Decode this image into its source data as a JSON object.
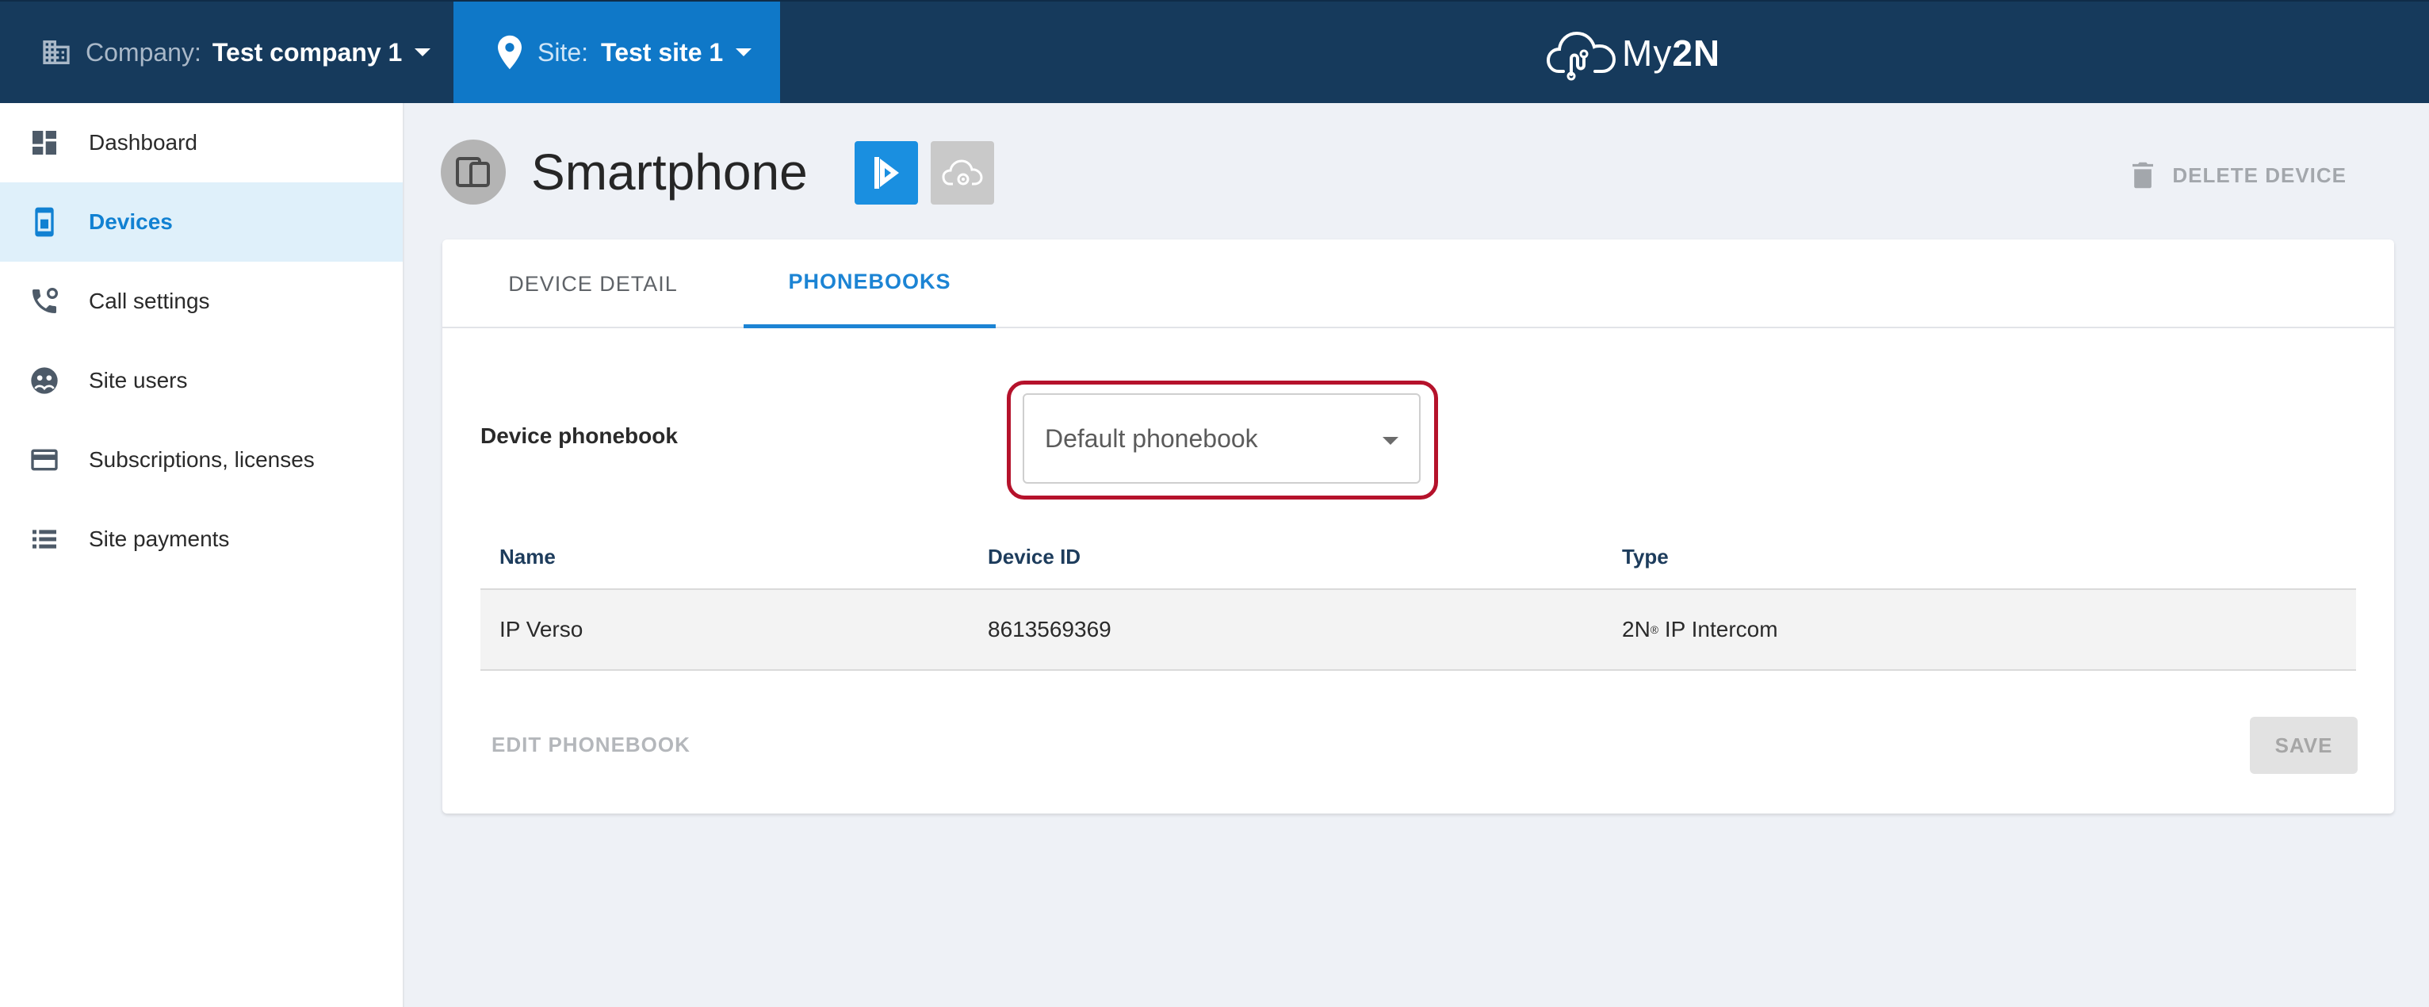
{
  "topbar": {
    "company_label": "Company:",
    "company_value": "Test company 1",
    "site_label": "Site:",
    "site_value": "Test site 1",
    "logo_text_a": "My",
    "logo_text_b": "2N"
  },
  "sidebar": {
    "items": [
      {
        "label": "Dashboard",
        "icon": "dashboard-icon"
      },
      {
        "label": "Devices",
        "icon": "devices-icon",
        "active": true
      },
      {
        "label": "Call settings",
        "icon": "call-settings-icon"
      },
      {
        "label": "Site users",
        "icon": "site-users-icon"
      },
      {
        "label": "Subscriptions, licenses",
        "icon": "credit-card-icon"
      },
      {
        "label": "Site payments",
        "icon": "list-icon"
      }
    ]
  },
  "header": {
    "title": "Smartphone",
    "delete_label": "DELETE DEVICE"
  },
  "tabs": [
    {
      "label": "DEVICE DETAIL"
    },
    {
      "label": "PHONEBOOKS",
      "active": true
    }
  ],
  "phonebook": {
    "label": "Device phonebook",
    "selected": "Default phonebook"
  },
  "table": {
    "columns": [
      "Name",
      "Device ID",
      "Type"
    ],
    "rows": [
      {
        "name": "IP Verso",
        "device_id": "8613569369",
        "type_prefix": "2N",
        "type_mark": "®",
        "type_rest": " IP Intercom"
      }
    ]
  },
  "actions": {
    "edit_label": "EDIT PHONEBOOK",
    "save_label": "SAVE"
  },
  "colors": {
    "topbar": "#163a5c",
    "site_accent": "#0f78c8",
    "active_text": "#1181d2",
    "highlight": "#b5122b"
  }
}
